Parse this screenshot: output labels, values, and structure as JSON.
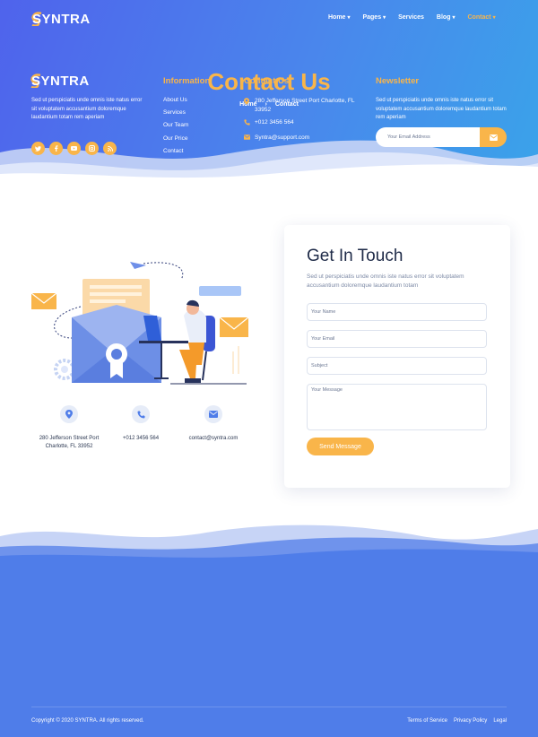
{
  "brand": {
    "name": "SYNTRA"
  },
  "colors": {
    "accent": "#f9b54a",
    "hero_start": "#4f63ec",
    "hero_end": "#3aa3ea",
    "footer_bg": "#4f7de9",
    "heading": "#1f2b48"
  },
  "nav": {
    "items": [
      {
        "label": "Home",
        "dropdown": true,
        "active": false
      },
      {
        "label": "Pages",
        "dropdown": true,
        "active": false
      },
      {
        "label": "Services",
        "dropdown": false,
        "active": false
      },
      {
        "label": "Blog",
        "dropdown": true,
        "active": false
      },
      {
        "label": "Contact",
        "dropdown": true,
        "active": true
      }
    ]
  },
  "hero": {
    "title": "Contact Us",
    "breadcrumb": {
      "home": "Home",
      "current": "Contact"
    }
  },
  "info": {
    "address": {
      "icon": "map-pin-icon",
      "line1": "280 Jefferson Street Port",
      "line2": "Charlotte, FL 33952"
    },
    "phone": {
      "icon": "phone-icon",
      "text": "+012 3456 564"
    },
    "email": {
      "icon": "envelope-icon",
      "text": "contact@syntra.com"
    }
  },
  "form": {
    "title": "Get In Touch",
    "description": "Sed ut perspiciatis unde omnis iste natus error sit voluptatem accusantium doloremque laudantium totam",
    "name_placeholder": "Your Name",
    "email_placeholder": "Your Email",
    "subject_placeholder": "Subject",
    "message_placeholder": "Your Message",
    "submit_label": "Send Message"
  },
  "footer": {
    "description": "Sed ut perspiciatis unde omnis iste natus error sit voluptatem accusantium doloremque laudantium totam rem aperiam",
    "socials": [
      "twitter-icon",
      "facebook-icon",
      "youtube-icon",
      "instagram-icon",
      "rss-icon"
    ],
    "information": {
      "heading": "Information",
      "links": [
        "About Us",
        "Services",
        "Our Team",
        "Our Price",
        "Contact"
      ]
    },
    "contact": {
      "heading": "Contact Us",
      "address": "280 Jefferson Street Port Charlotte, FL 33952",
      "phone": "+012 3456 564",
      "email": "Syntra@support.com"
    },
    "newsletter": {
      "heading": "Newsletter",
      "description": "Sed ut perspiciatis unde omnis iste natus error sit voluptatem accusantium doloremque laudantium totam rem aperiam",
      "placeholder": "Your Email Address"
    },
    "copyright": "Copyright © 2020 SYNTRA. All rights reserved.",
    "legal": [
      "Terms of Service",
      "Privacy Policy",
      "Legal"
    ]
  }
}
